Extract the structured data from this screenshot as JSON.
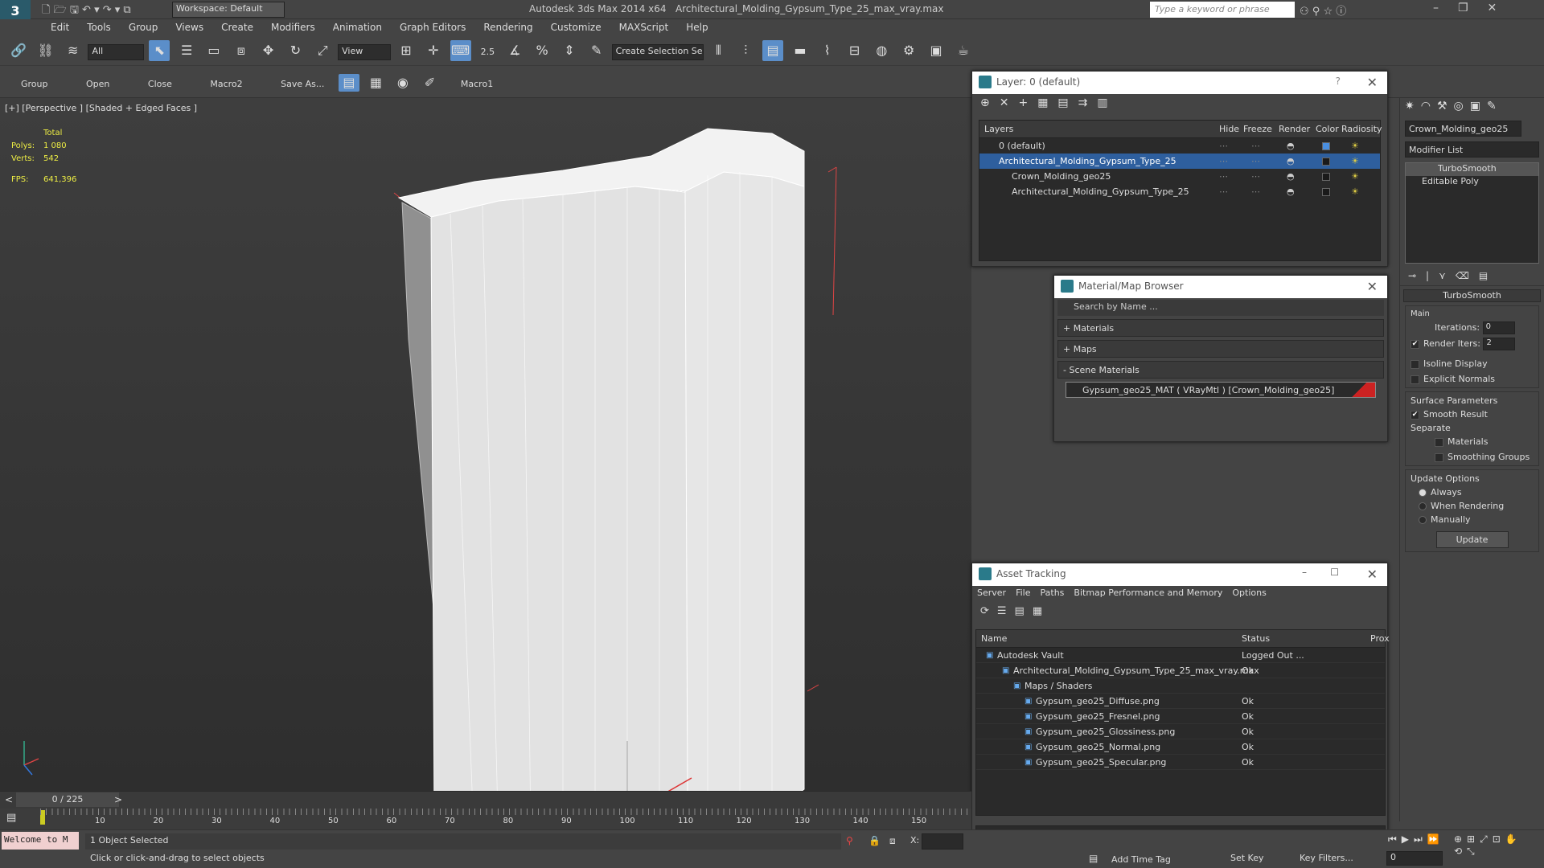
{
  "app": {
    "title": "Autodesk 3ds Max  2014 x64",
    "file": "Architectural_Molding_Gypsum_Type_25_max_vray.max",
    "workspace": "Workspace: Default",
    "search_placeholder": "Type a keyword or phrase"
  },
  "menu": [
    "Edit",
    "Tools",
    "Group",
    "Views",
    "Create",
    "Modifiers",
    "Animation",
    "Graph Editors",
    "Rendering",
    "Customize",
    "MAXScript",
    "Help"
  ],
  "toolbar": {
    "selection_filter": "All",
    "ref_coord": "View",
    "angle_snap": "2.5",
    "named_selection": "Create Selection Se"
  },
  "toolbar2": [
    "Group",
    "Open",
    "Close",
    "Macro2",
    "Save As...",
    "Macro1"
  ],
  "viewport": {
    "label": "[+] [Perspective ] [Shaded + Edged Faces ]",
    "stats_header": "Total",
    "polys_label": "Polys:",
    "polys_value": "1 080",
    "verts_label": "Verts:",
    "verts_value": "542",
    "fps_label": "FPS:",
    "fps_value": "641,396"
  },
  "layer_window": {
    "title": "Layer: 0 (default)",
    "columns": [
      "Layers",
      "Hide",
      "Freeze",
      "Render",
      "Color",
      "Radiosity"
    ],
    "rows": [
      {
        "name": "0 (default)",
        "color": "#4a8fe0"
      },
      {
        "name": "Architectural_Molding_Gypsum_Type_25",
        "color": "#1a1a1a"
      },
      {
        "name": "Crown_Molding_geo25",
        "color": "#1a1a1a"
      },
      {
        "name": "Architectural_Molding_Gypsum_Type_25",
        "color": "#1a1a1a"
      }
    ]
  },
  "material_browser": {
    "title": "Material/Map Browser",
    "search_placeholder": "Search by Name ...",
    "sections": [
      "+ Materials",
      "+ Maps",
      "- Scene Materials"
    ],
    "scene_material": "Gypsum_geo25_MAT ( VRayMtl ) [Crown_Molding_geo25]"
  },
  "asset_tracking": {
    "title": "Asset Tracking",
    "menu": [
      "Server",
      "File",
      "Paths",
      "Bitmap Performance and Memory",
      "Options"
    ],
    "columns": [
      "Name",
      "Status",
      "Prox"
    ],
    "rows": [
      {
        "name": "Autodesk Vault",
        "status": "Logged Out ..."
      },
      {
        "name": "Architectural_Molding_Gypsum_Type_25_max_vray.max",
        "status": "Ok"
      },
      {
        "name": "Maps / Shaders",
        "status": ""
      },
      {
        "name": "Gypsum_geo25_Diffuse.png",
        "status": "Ok"
      },
      {
        "name": "Gypsum_geo25_Fresnel.png",
        "status": "Ok"
      },
      {
        "name": "Gypsum_geo25_Glossiness.png",
        "status": "Ok"
      },
      {
        "name": "Gypsum_geo25_Normal.png",
        "status": "Ok"
      },
      {
        "name": "Gypsum_geo25_Specular.png",
        "status": "Ok"
      }
    ]
  },
  "command_panel": {
    "object_name": "Crown_Molding_geo25",
    "modifier_list": "Modifier List",
    "stack": [
      "TurboSmooth",
      "Editable Poly"
    ],
    "rollout_title": "TurboSmooth",
    "main_label": "Main",
    "iterations_label": "Iterations:",
    "iterations_value": "0",
    "render_iters_label": "Render Iters:",
    "render_iters_value": "2",
    "isoline": "Isoline Display",
    "explicit_normals": "Explicit Normals",
    "surface_params": "Surface Parameters",
    "smooth_result": "Smooth Result",
    "separate": "Separate",
    "materials": "Materials",
    "smoothing_groups": "Smoothing Groups",
    "update_options": "Update Options",
    "always": "Always",
    "when_rendering": "When Rendering",
    "manually": "Manually",
    "update_btn": "Update"
  },
  "timeline": {
    "frame": "0 / 225",
    "ticks": [
      "10",
      "20",
      "30",
      "40",
      "50",
      "60",
      "70",
      "80",
      "90",
      "100",
      "110",
      "120",
      "130",
      "140",
      "150"
    ]
  },
  "status": {
    "welcome": "Welcome to M",
    "selected": "1 Object Selected",
    "prompt": "Click or click-and-drag to select objects",
    "x_label": "X:",
    "add_time_tag": "Add Time Tag",
    "set_key": "Set Key",
    "key_filters": "Key Filters...",
    "frame_field": "0"
  }
}
